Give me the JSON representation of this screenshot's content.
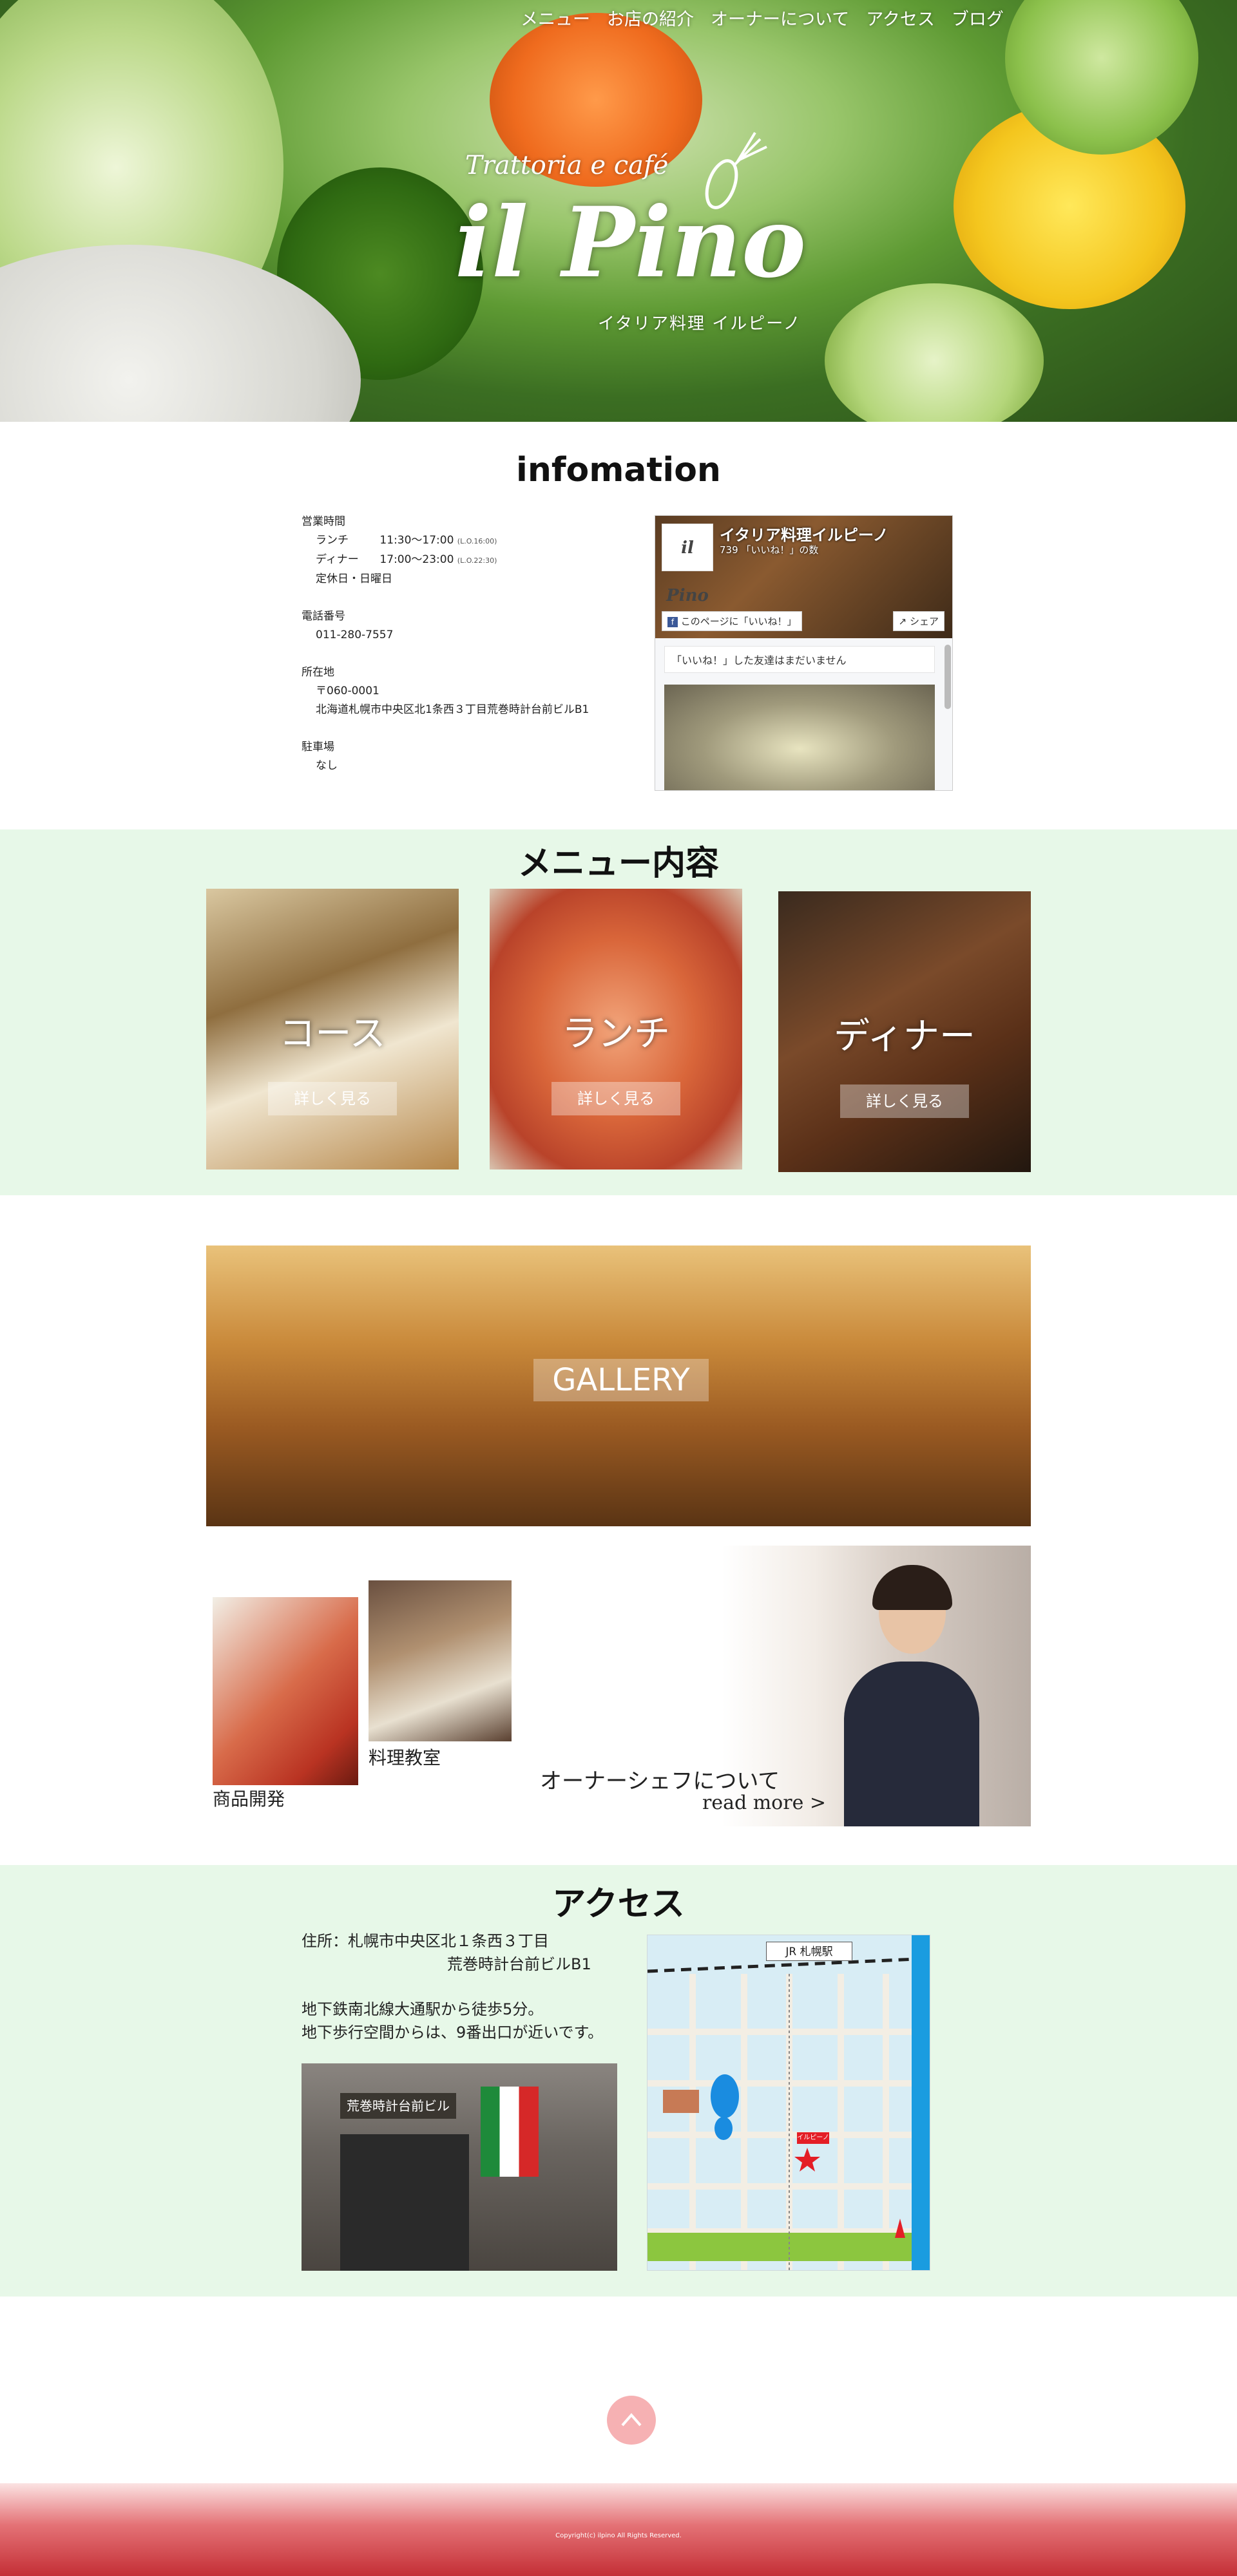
{
  "nav": {
    "items": [
      "メニュー",
      "お店の紹介",
      "オーナーについて",
      "アクセス",
      "ブログ"
    ]
  },
  "hero": {
    "logo_sub": "Trattoria e café",
    "logo_main": "il Pino",
    "logo_jp": "イタリア料理 イルピーノ"
  },
  "info": {
    "title": "infomation",
    "hours_label": "営業時間",
    "lunch_label": "ランチ",
    "lunch_time": "11:30〜17:00",
    "lunch_lo": "(L.O.16:00)",
    "dinner_label": "ディナー",
    "dinner_time": "17:00〜23:00",
    "dinner_lo": "(L.O.22:30)",
    "holiday": "定休日・日曜日",
    "phone_label": "電話番号",
    "phone": "011-280-7557",
    "address_label": "所在地",
    "postal": "〒060-0001",
    "address": "北海道札幌市中央区北1条西３丁目荒巻時計台前ビルB1",
    "parking_label": "駐車場",
    "parking": "なし"
  },
  "facebook": {
    "page_name": "イタリア料理イルピーノ",
    "likes": "739 「いいね！」の数",
    "logo": "il Pino",
    "like_button": "このページに「いいね！」",
    "share_button": "シェア",
    "friends_text": "「いいね！」した友達はまだいません"
  },
  "menu": {
    "title": "メニュー内容",
    "cards": [
      {
        "label": "コース",
        "button": "詳しく見る"
      },
      {
        "label": "ランチ",
        "button": "詳しく見る"
      },
      {
        "label": "ディナー",
        "button": "詳しく見る"
      }
    ]
  },
  "gallery": {
    "label": "GALLERY"
  },
  "features": {
    "product_label": "商品開発",
    "class_label": "料理教室",
    "owner_title": "オーナーシェフについて",
    "owner_more": "read more >"
  },
  "access": {
    "title": "アクセス",
    "address_line1": "住所：札幌市中央区北１条西３丁目",
    "address_line2": "荒巻時計台前ビルB1",
    "directions_line1": "地下鉄南北線大通駅から徒歩5分。",
    "directions_line2": "地下歩行空間からは、9番出口が近いです。",
    "building_sign": "荒巻時計台前ビル",
    "map_station": "JR 札幌駅",
    "map_shop": "イルピーノ"
  },
  "footer": {
    "copyright": "Copyright(c) ilpino All Rights Reserved."
  },
  "colors": {
    "band_green": "#e7f8e8",
    "top_button": "#f6b1b3",
    "footer_red": "#c42f36"
  }
}
